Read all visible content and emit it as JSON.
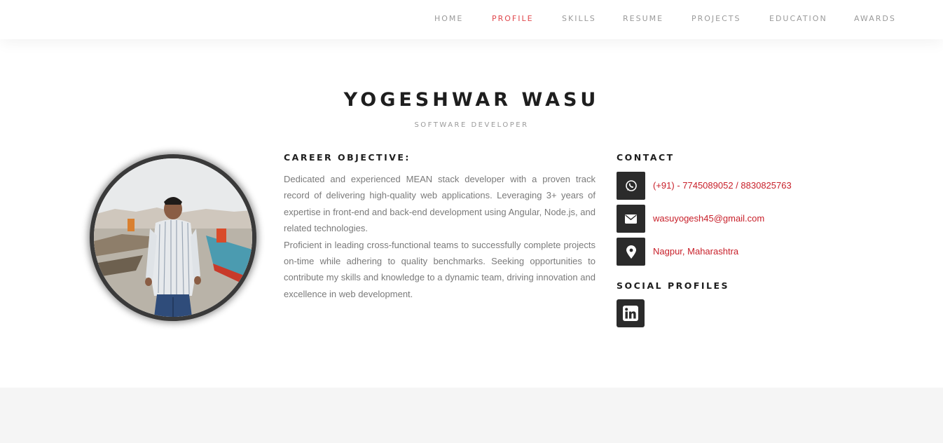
{
  "nav": {
    "items": [
      {
        "label": "HOME",
        "active": false
      },
      {
        "label": "PROFILE",
        "active": true
      },
      {
        "label": "SKILLS",
        "active": false
      },
      {
        "label": "RESUME",
        "active": false
      },
      {
        "label": "PROJECTS",
        "active": false
      },
      {
        "label": "EDUCATION",
        "active": false
      },
      {
        "label": "AWARDS",
        "active": false
      }
    ],
    "active_color": "#e0474c",
    "color": "#9a9a9a"
  },
  "profile": {
    "name": "YOGESHWAR WASU",
    "title": "SOFTWARE DEVELOPER",
    "photo_icon": "profile-photo"
  },
  "career": {
    "heading": "CAREER OBJECTIVE:",
    "paragraph1": "Dedicated and experienced MEAN stack developer with a proven track record of delivering high-quality web applications. Leveraging 3+ years of expertise in front-end and back-end development using Angular, Node.js, and related technologies.",
    "paragraph2": "Proficient in leading cross-functional teams to successfully complete projects on-time while adhering to quality benchmarks. Seeking opportunities to contribute my skills and knowledge to a dynamic team, driving innovation and excellence in web development."
  },
  "contact": {
    "heading": "CONTACT",
    "phone": {
      "icon": "whatsapp-icon",
      "text": "(+91) - 7745089052 / 8830825763"
    },
    "email": {
      "icon": "envelope-icon",
      "text": "wasuyogesh45@gmail.com"
    },
    "location": {
      "icon": "map-marker-icon",
      "text": "Nagpur, Maharashtra"
    },
    "link_color": "#c8202a"
  },
  "social": {
    "heading": "SOCIAL PROFILES",
    "items": [
      {
        "icon": "linkedin-icon"
      }
    ]
  }
}
